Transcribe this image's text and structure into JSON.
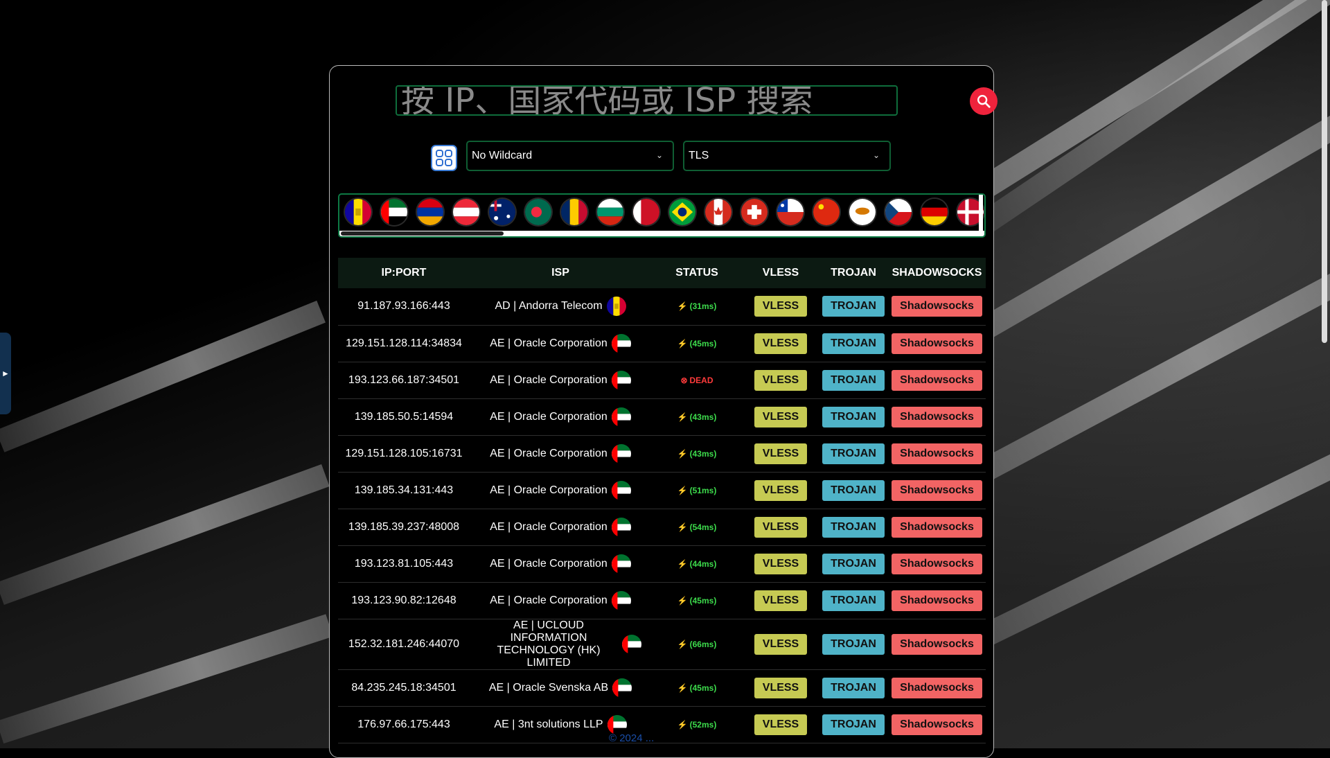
{
  "search": {
    "placeholder": "按 IP、国家代码或 ISP 搜索"
  },
  "filters": {
    "wildcard": "No Wildcard",
    "security": "TLS"
  },
  "flag_strip": {
    "countries": [
      "AD",
      "AE",
      "AM",
      "AT",
      "AU",
      "BD",
      "TD",
      "BG",
      "BH",
      "BR",
      "CA",
      "CH",
      "CL",
      "CN",
      "CY",
      "CZ",
      "DE",
      "DK"
    ]
  },
  "table": {
    "headers": {
      "ip": "IP:PORT",
      "isp": "ISP",
      "status": "STATUS",
      "vless": "VLESS",
      "trojan": "TROJAN",
      "ss": "SHADOWSOCKS"
    },
    "button_labels": {
      "vless": "VLESS",
      "trojan": "TROJAN",
      "ss": "Shadowsocks"
    },
    "rows": [
      {
        "ip": "91.187.93.166:443",
        "isp": "AD | Andorra Telecom",
        "flag": "AD",
        "status": "(31ms)",
        "alive": true
      },
      {
        "ip": "129.151.128.114:34834",
        "isp": "AE | Oracle Corporation",
        "flag": "AE",
        "status": "(45ms)",
        "alive": true
      },
      {
        "ip": "193.123.66.187:34501",
        "isp": "AE | Oracle Corporation",
        "flag": "AE",
        "status": "DEAD",
        "alive": false
      },
      {
        "ip": "139.185.50.5:14594",
        "isp": "AE | Oracle Corporation",
        "flag": "AE",
        "status": "(43ms)",
        "alive": true
      },
      {
        "ip": "129.151.128.105:16731",
        "isp": "AE | Oracle Corporation",
        "flag": "AE",
        "status": "(43ms)",
        "alive": true
      },
      {
        "ip": "139.185.34.131:443",
        "isp": "AE | Oracle Corporation",
        "flag": "AE",
        "status": "(51ms)",
        "alive": true
      },
      {
        "ip": "139.185.39.237:48008",
        "isp": "AE | Oracle Corporation",
        "flag": "AE",
        "status": "(54ms)",
        "alive": true
      },
      {
        "ip": "193.123.81.105:443",
        "isp": "AE | Oracle Corporation",
        "flag": "AE",
        "status": "(44ms)",
        "alive": true
      },
      {
        "ip": "193.123.90.82:12648",
        "isp": "AE | Oracle Corporation",
        "flag": "AE",
        "status": "(45ms)",
        "alive": true
      },
      {
        "ip": "152.32.181.246:44070",
        "isp": "AE | UCLOUD INFORMATION TECHNOLOGY (HK) LIMITED",
        "flag": "AE",
        "status": "(66ms)",
        "alive": true
      },
      {
        "ip": "84.235.245.18:34501",
        "isp": "AE | Oracle Svenska AB",
        "flag": "AE",
        "status": "(45ms)",
        "alive": true
      },
      {
        "ip": "176.97.66.175:443",
        "isp": "AE | 3nt solutions LLP",
        "flag": "AE",
        "status": "(52ms)",
        "alive": true
      }
    ]
  },
  "colors": {
    "vless": "#c6ca53",
    "trojan": "#4fb3c8",
    "shadowsocks": "#f26464",
    "alive": "#3ddc4c",
    "dead": "#ff3b3b",
    "accent_border": "#0d7a44"
  },
  "side_tab": {
    "label": "►"
  },
  "footer": {
    "text": "© 2024 ..."
  }
}
